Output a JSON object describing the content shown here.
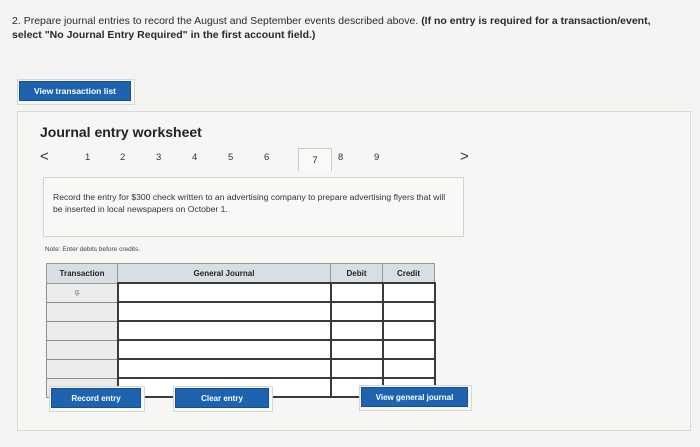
{
  "question": {
    "number": "2.",
    "text": "Prepare journal entries to record the August and September events described above.",
    "bold_text": "(If no entry is required for a transaction/event, select \"No Journal Entry Required\" in the first account field.)"
  },
  "view_transaction_list": "View transaction list",
  "worksheet": {
    "title": "Journal entry worksheet",
    "prev_arrow": "<",
    "next_arrow": ">",
    "pages": [
      "1",
      "2",
      "3",
      "4",
      "5",
      "6",
      "7",
      "8",
      "9"
    ],
    "active_page": "7",
    "description": "Record the entry for $300 check written to an advertising company to prepare advertising flyers that will be inserted in local newspapers on October 1.",
    "note": "Note: Enter debits before credits.",
    "table": {
      "headers": [
        "Transaction",
        "General Journal",
        "Debit",
        "Credit"
      ],
      "rows": [
        {
          "transaction": "g.",
          "journal": "",
          "debit": "",
          "credit": ""
        },
        {
          "transaction": "",
          "journal": "",
          "debit": "",
          "credit": ""
        },
        {
          "transaction": "",
          "journal": "",
          "debit": "",
          "credit": ""
        },
        {
          "transaction": "",
          "journal": "",
          "debit": "",
          "credit": ""
        },
        {
          "transaction": "",
          "journal": "",
          "debit": "",
          "credit": ""
        },
        {
          "transaction": "",
          "journal": "",
          "debit": "",
          "credit": ""
        }
      ]
    },
    "buttons": {
      "record": "Record entry",
      "clear": "Clear entry",
      "view_journal": "View general journal"
    }
  },
  "colors": {
    "button_blue": "#1e63b0",
    "header_gray": "#d9dee3"
  }
}
